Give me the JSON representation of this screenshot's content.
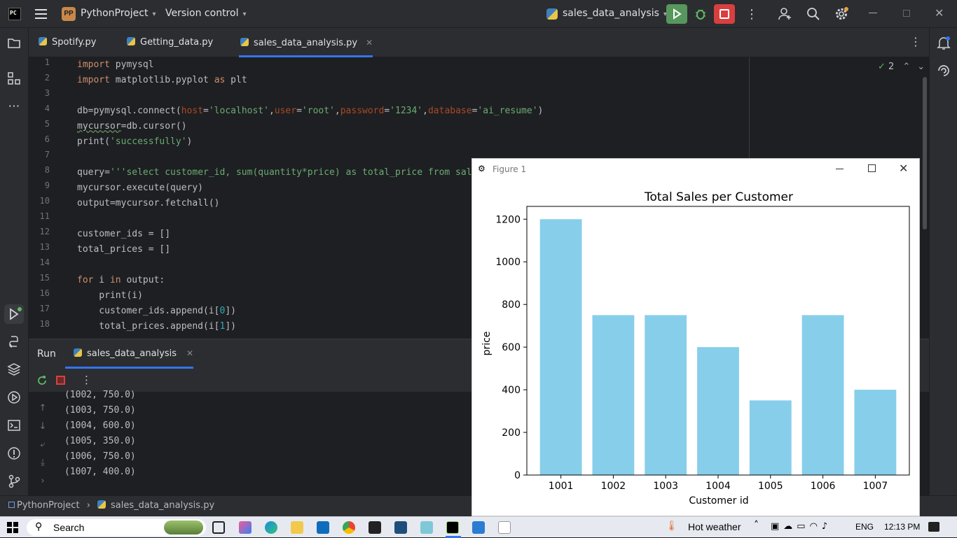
{
  "topbar": {
    "project": "PythonProject",
    "project_badge": "PP",
    "version_control": "Version control",
    "run_config": "sales_data_analysis",
    "logo": "PC"
  },
  "tabs": [
    {
      "label": "Spotify.py"
    },
    {
      "label": "Getting_data.py"
    },
    {
      "label": "sales_data_analysis.py"
    }
  ],
  "editor": {
    "line_numbers": [
      "1",
      "2",
      "3",
      "4",
      "5",
      "6",
      "7",
      "8",
      "9",
      "10",
      "11",
      "12",
      "13",
      "14",
      "15",
      "16",
      "17",
      "18"
    ],
    "inspection_count": "2"
  },
  "run": {
    "title": "Run",
    "tab_label": "sales_data_analysis",
    "output": [
      "(1002, 750.0)",
      "(1003, 750.0)",
      "(1004, 600.0)",
      "(1005, 350.0)",
      "(1006, 750.0)",
      "(1007, 400.0)"
    ]
  },
  "breadcrumb": {
    "project": "PythonProject",
    "file": "sales_data_analysis.py"
  },
  "figure": {
    "window_title": "Figure 1"
  },
  "chart_data": {
    "type": "bar",
    "title": "Total Sales per Customer",
    "xlabel": "Customer id",
    "ylabel": "price",
    "categories": [
      "1001",
      "1002",
      "1003",
      "1004",
      "1005",
      "1006",
      "1007"
    ],
    "values": [
      1200,
      750,
      750,
      600,
      350,
      750,
      400
    ],
    "ylim": [
      0,
      1260
    ],
    "yticks": [
      0,
      200,
      400,
      600,
      800,
      1000,
      1200
    ],
    "bar_color": "#87ceeb",
    "grid": false
  },
  "taskbar": {
    "search": "Search",
    "weather": "Hot weather",
    "lang": "ENG",
    "time": "12:13 PM"
  }
}
